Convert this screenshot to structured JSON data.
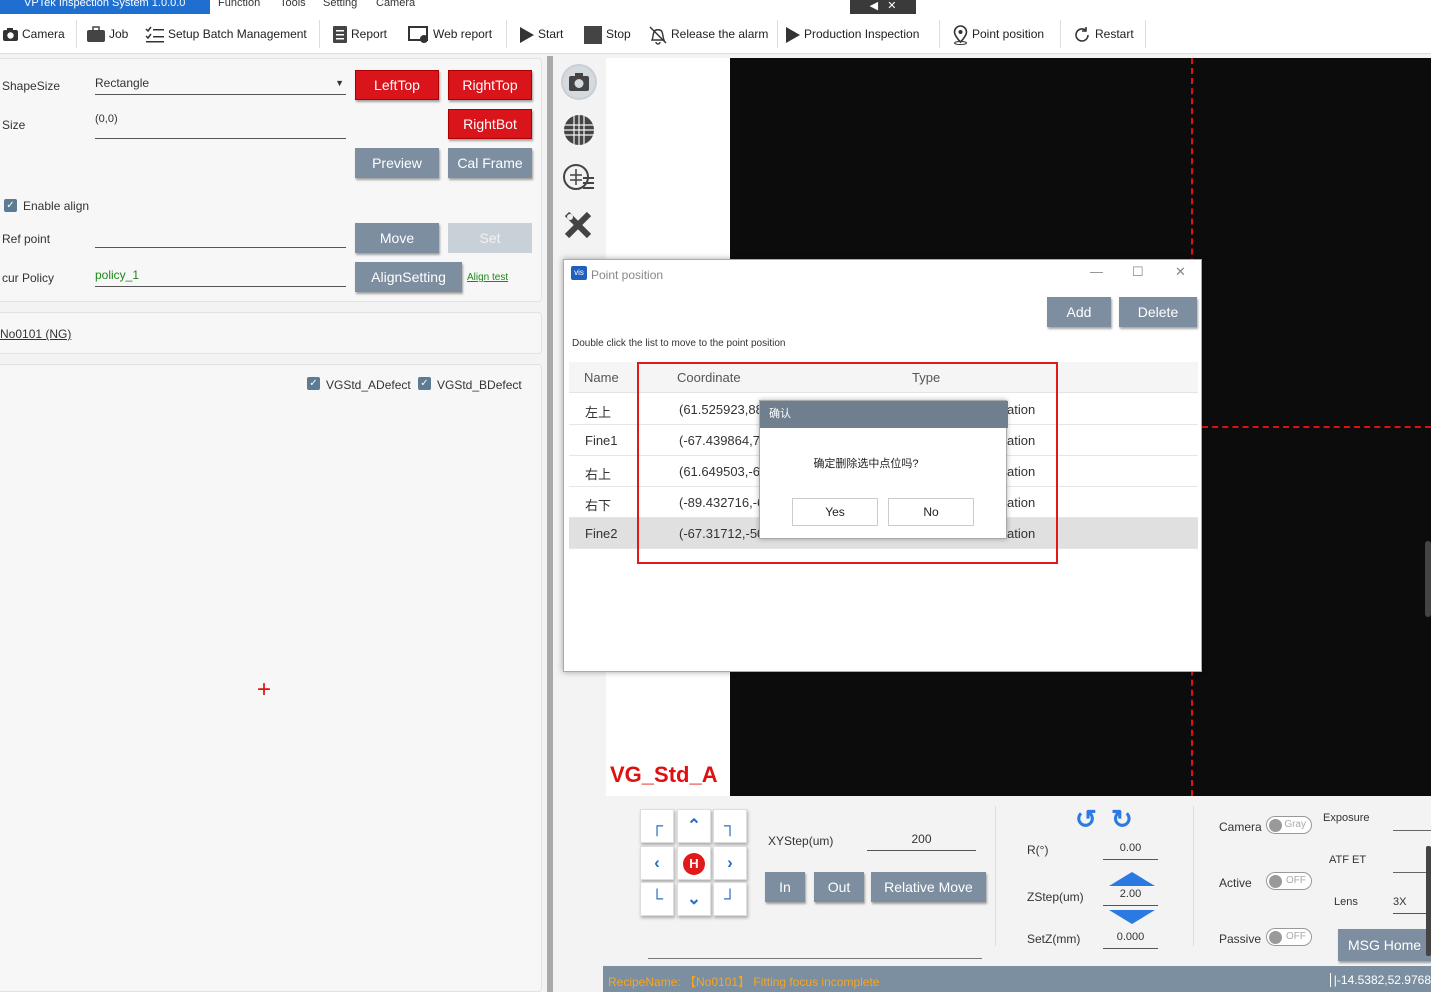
{
  "window": {
    "app_title": "VPTek Inspection System 1.0.0.0",
    "menu": [
      "Function",
      "Tools",
      "Setting",
      "Camera"
    ]
  },
  "toolbar": {
    "camera": "Camera",
    "job": "Job",
    "setup_batch": "Setup Batch Management",
    "report": "Report",
    "web_report": "Web report",
    "start": "Start",
    "stop": "Stop",
    "release_alarm": "Release the alarm",
    "production_inspection": "Production Inspection",
    "point_position": "Point position",
    "restart": "Restart"
  },
  "settings": {
    "shape_size_label": "ShapeSize",
    "shape_size_value": "Rectangle",
    "size_label": "Size",
    "size_value": "(0,0)",
    "left_top": "LeftTop",
    "right_top": "RightTop",
    "right_bot": "RightBot",
    "preview": "Preview",
    "cal_frame": "Cal Frame",
    "enable_align": "Enable align",
    "ref_point_label": "Ref point",
    "ref_point_value": "",
    "move": "Move",
    "set": "Set",
    "cur_policy_label": "cur Policy",
    "cur_policy_value": "policy_1",
    "align_setting": "AlignSetting",
    "align_test": "Align test"
  },
  "recipe": {
    "name": "No0101 (NG)"
  },
  "defects": [
    "VGStd_ADefect",
    "VGStd_BDefect"
  ],
  "view": {
    "label": "VG_Std_A",
    "crosshair_color": "#e01010"
  },
  "point_window": {
    "title": "Point position",
    "add": "Add",
    "delete": "Delete",
    "hint": "Double click the list to move to the point position",
    "columns": [
      "Name",
      "Coordinate",
      "Type"
    ],
    "rows": [
      {
        "name": "左上",
        "coordinate": "(61.525923,88",
        "type": "ation"
      },
      {
        "name": "Fine1",
        "coordinate": "(-67.439864,7",
        "type": "ation"
      },
      {
        "name": "右上",
        "coordinate": "(61.649503,-6",
        "type": "ation"
      },
      {
        "name": "右下",
        "coordinate": "(-89.432716,-6",
        "type": "ation"
      },
      {
        "name": "Fine2",
        "coordinate": "(-67.31712,-50",
        "type": "ation"
      }
    ]
  },
  "confirm_dialog": {
    "title": "确认",
    "message": "确定删除选中点位吗?",
    "yes": "Yes",
    "no": "No"
  },
  "motion": {
    "home": "H",
    "xy_step_label": "XYStep(um)",
    "xy_step_value": "200",
    "in": "In",
    "out": "Out",
    "relative_move": "Relative Move",
    "r_label": "R(°)",
    "r_value": "0.00",
    "zstep_label": "ZStep(um)",
    "zstep_value": "2.00",
    "setz_label": "SetZ(mm)",
    "setz_value": "0.000"
  },
  "camera_ctrl": {
    "camera_label": "Camera",
    "camera_toggle": "Gray",
    "exposure_label": "Exposure",
    "atf_label": "ATF ET",
    "active_label": "Active",
    "active_toggle": "OFF",
    "lens_label": "Lens",
    "lens_value": "3X",
    "passive_label": "Passive",
    "passive_toggle": "OFF",
    "msg_home": "MSG Home"
  },
  "status": {
    "message": "RecipeName: 【No0101】 Fitting focus incomplete",
    "coords": "|-14.5382,52.9768"
  }
}
